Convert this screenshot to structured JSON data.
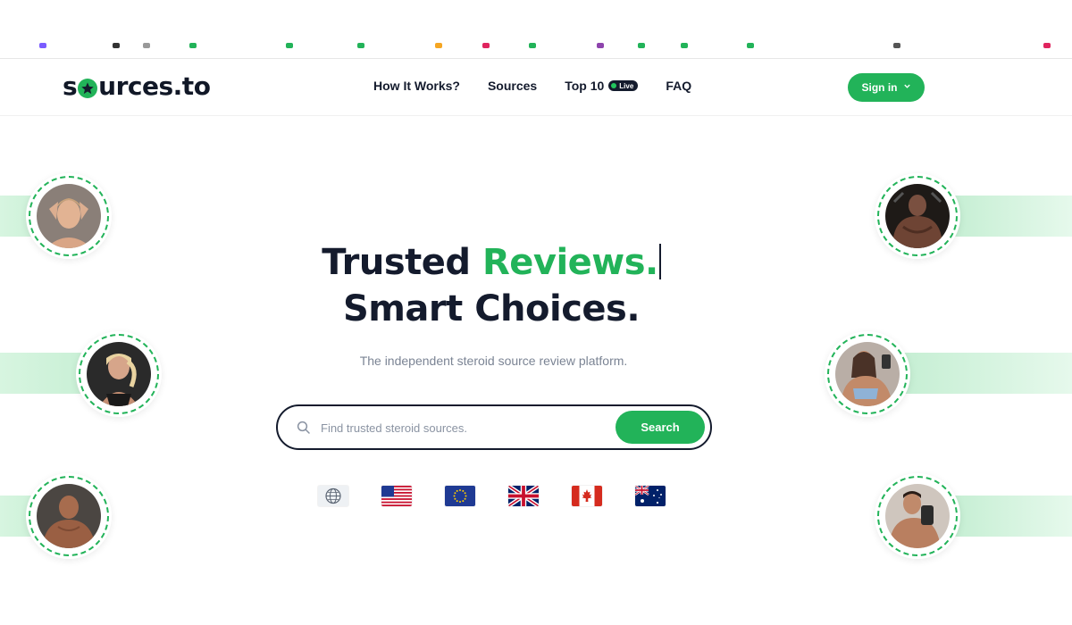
{
  "brand": {
    "name_prefix": "s",
    "name_suffix": "urces.to",
    "accent": "#22b359",
    "dark": "#141b2d"
  },
  "nav": {
    "how_it_works": "How It Works?",
    "sources": "Sources",
    "top10": "Top 10",
    "live_badge": "Live",
    "faq": "FAQ",
    "sign_in": "Sign in"
  },
  "hero": {
    "title_part1": "Trusted ",
    "title_highlight": "Reviews.",
    "title_line2": "Smart Choices.",
    "subtitle": "The independent steroid source review platform."
  },
  "search": {
    "placeholder": "Find trusted steroid sources.",
    "button": "Search"
  },
  "flags": [
    {
      "name": "global-flag-icon",
      "label": "Global"
    },
    {
      "name": "usa-flag-icon",
      "label": "USA"
    },
    {
      "name": "eu-flag-icon",
      "label": "EU"
    },
    {
      "name": "uk-flag-icon",
      "label": "UK"
    },
    {
      "name": "canada-flag-icon",
      "label": "Canada"
    },
    {
      "name": "australia-flag-icon",
      "label": "Australia"
    }
  ]
}
